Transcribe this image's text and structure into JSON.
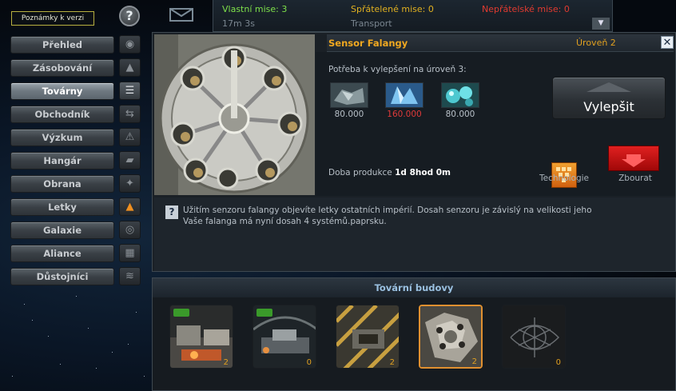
{
  "top": {
    "notes_label": "Poznámky k verzi",
    "help_label": "?"
  },
  "nav": {
    "items": [
      {
        "label": "Přehled",
        "icon": "planet-icon",
        "glyph": "◉"
      },
      {
        "label": "Zásobování",
        "icon": "supply-icon",
        "glyph": "▲"
      },
      {
        "label": "Továrny",
        "icon": "factory-icon",
        "glyph": "☰",
        "active": true
      },
      {
        "label": "Obchodník",
        "icon": "trade-arrows-icon",
        "glyph": "⇆"
      },
      {
        "label": "Výzkum",
        "icon": "research-icon",
        "glyph": "⚠"
      },
      {
        "label": "Hangár",
        "icon": "hangar-icon",
        "glyph": "▰"
      },
      {
        "label": "Obrana",
        "icon": "defense-icon",
        "glyph": "✦"
      },
      {
        "label": "Letky",
        "icon": "fleet-icon",
        "glyph": "▲",
        "alert": true
      },
      {
        "label": "Galaxie",
        "icon": "galaxy-icon",
        "glyph": "◎"
      },
      {
        "label": "Aliance",
        "icon": "alliance-icon",
        "glyph": "▦"
      },
      {
        "label": "Důstojníci",
        "icon": "officers-icon",
        "glyph": "≋"
      }
    ]
  },
  "missions": {
    "own": "Vlastní mise: 3",
    "friendly": "Spřátelené mise: 0",
    "hostile": "Nepřátelské mise: 0",
    "time": "17m 3s",
    "type": "Transport",
    "colors": {
      "own": "#7ee04a",
      "friendly": "#e0b020",
      "hostile": "#e03a30"
    }
  },
  "building": {
    "title": "Sensor Falangy",
    "level": "Úroveň 2",
    "requirement_label": "Potřeba k vylepšení na úroveň 3:",
    "resources": [
      {
        "icon": "metal-icon",
        "value": "80.000",
        "sufficient": true
      },
      {
        "icon": "crystal-icon",
        "value": "160.000",
        "sufficient": false
      },
      {
        "icon": "deuterium-icon",
        "value": "80.000",
        "sufficient": true
      }
    ],
    "upgrade_label": "Vylepšit",
    "production_label": "Doba produkce",
    "production_time": "1d 8hod 0m",
    "technology_label": "Technologie",
    "demolish_label": "Zbourat",
    "description_line1": "Užitím senzoru falangy objevíte letky ostatních impérií. Dosah senzoru je závislý na velikosti jeho",
    "description_line2": "Vaše falanga má nyní dosah 4 systémů.paprsku."
  },
  "factory_buildings": {
    "title": "Tovární budovy",
    "items": [
      {
        "name": "factory-building-1",
        "count": "2",
        "badge": true
      },
      {
        "name": "factory-building-2",
        "count": "0",
        "badge": true
      },
      {
        "name": "factory-building-3",
        "count": "2",
        "badge": false
      },
      {
        "name": "sensor-phalanx",
        "count": "2",
        "badge": false,
        "selected": true
      },
      {
        "name": "factory-building-5",
        "count": "0",
        "badge": false
      }
    ]
  }
}
